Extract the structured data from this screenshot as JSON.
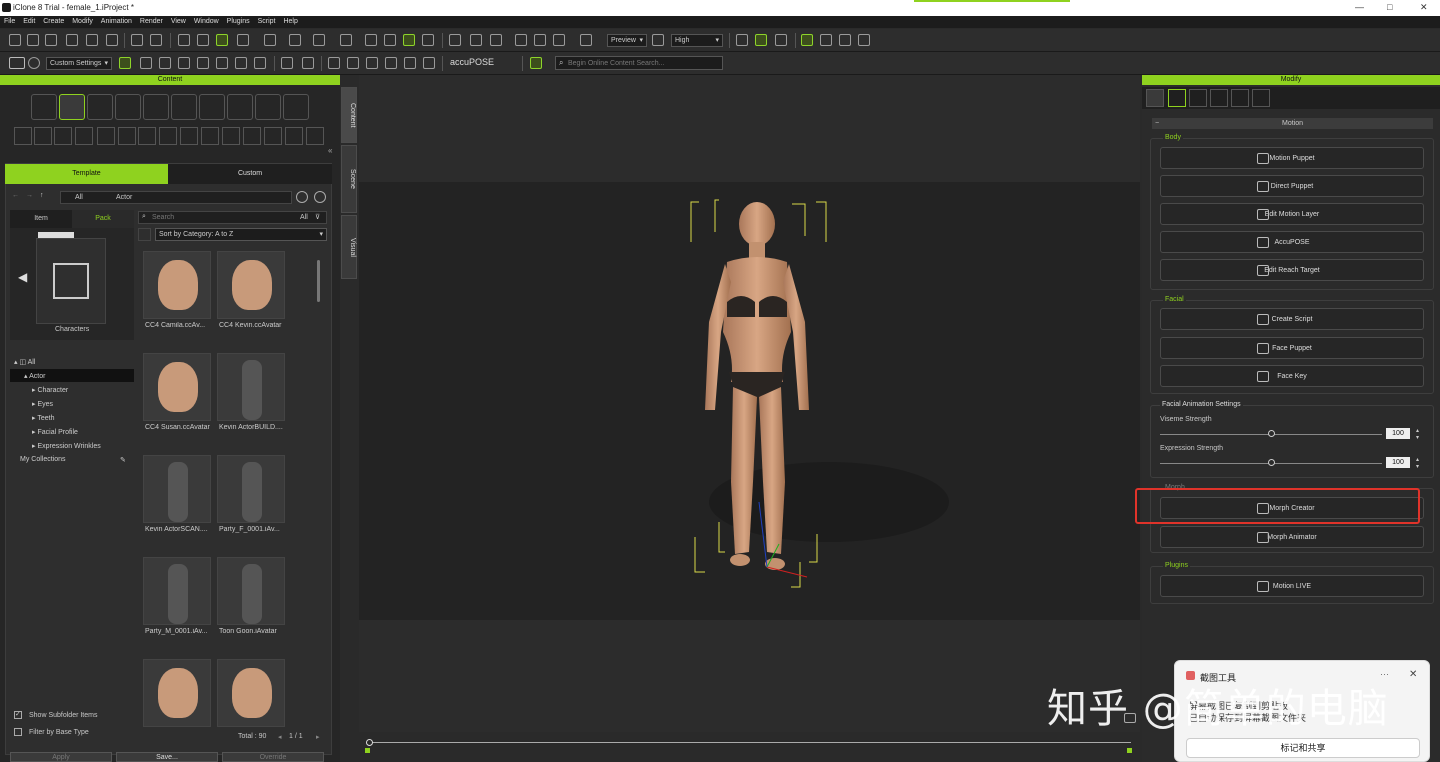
{
  "window": {
    "title": "iClone 8 Trial - female_1.iProject *",
    "controls": [
      "—",
      "□",
      "✕"
    ]
  },
  "menu": [
    "File",
    "Edit",
    "Create",
    "Modify",
    "Animation",
    "Render",
    "View",
    "Window",
    "Plugins",
    "Script",
    "Help"
  ],
  "toolbar": {
    "preview_label": "Preview",
    "quality_label": "High",
    "custom_settings": "Custom Settings",
    "accupose": "accuPOSE",
    "search_placeholder": "Begin Online Content Search..."
  },
  "content_panel": {
    "title": "Content",
    "tabs": [
      "Template",
      "Custom"
    ],
    "breadcrumb": [
      "All",
      "Actor"
    ],
    "subtabs": [
      "Item",
      "Pack"
    ],
    "search_placeholder": "Search",
    "search_scope": "All",
    "sort_label": "Sort by Category: A to Z",
    "preview_label": "Characters",
    "tree": [
      "All",
      "Actor",
      "Character",
      "Eyes",
      "Teeth",
      "Facial Profile",
      "Expression Wrinkles",
      "My Collections"
    ],
    "items": [
      {
        "name": "CC4 Camila.ccAv...",
        "kind": "face"
      },
      {
        "name": "CC4 Kevin.ccAvatar",
        "kind": "face"
      },
      {
        "name": "CC4 Susan.ccAvatar",
        "kind": "face"
      },
      {
        "name": "Kevin ActorBUILD....",
        "kind": "body"
      },
      {
        "name": "Kevin ActorSCAN....",
        "kind": "body"
      },
      {
        "name": "Party_F_0001.iAv...",
        "kind": "body"
      },
      {
        "name": "Party_M_0001.iAv...",
        "kind": "body"
      },
      {
        "name": "Toon Goon.iAvatar",
        "kind": "body"
      },
      {
        "name": "",
        "kind": "face"
      },
      {
        "name": "",
        "kind": "face"
      }
    ],
    "show_subfolder": "Show Subfolder Items",
    "filter_base": "Filter by Base Type",
    "total": "Total : 90",
    "page": "1 / 1",
    "buttons": [
      "Apply",
      "Save...",
      "Override"
    ]
  },
  "side_tabs": [
    "Content",
    "Scene",
    "Visual"
  ],
  "modify_panel": {
    "title": "Modify",
    "section": "Motion",
    "groups": {
      "body": {
        "label": "Body",
        "buttons": [
          "Motion Puppet",
          "Direct Puppet",
          "Edit Motion Layer",
          "AccuPOSE",
          "Edit Reach Target"
        ]
      },
      "facial": {
        "label": "Facial",
        "buttons": [
          "Create Script",
          "Face Puppet",
          "Face Key"
        ]
      },
      "facial_settings": {
        "label": "Facial Animation Settings",
        "viseme": "Viseme Strength",
        "viseme_value": "100",
        "expression": "Expression Strength",
        "expression_value": "100"
      },
      "morph": {
        "label": "Morph",
        "buttons": [
          "Morph Creator",
          "Morph Animator"
        ]
      },
      "plugins": {
        "label": "Plugins",
        "buttons": [
          "Motion LIVE"
        ]
      }
    }
  },
  "toast": {
    "title": "截图工具",
    "line1": "屏幕截图已复制到剪贴板",
    "line2": "已自动保存到屏幕截图文件夹",
    "action": "标记和共享"
  },
  "watermark": "知乎 @简单的电脑"
}
